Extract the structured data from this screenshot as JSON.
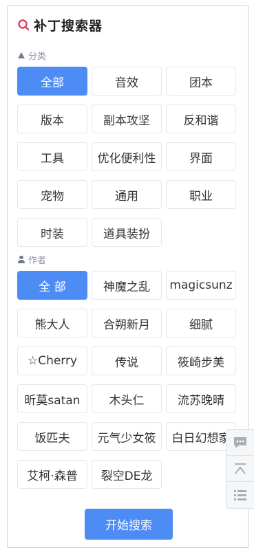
{
  "header": {
    "title": "补丁搜索器",
    "icon": "magnifier-icon"
  },
  "category": {
    "label": "分类",
    "items": [
      {
        "label": "全部",
        "active": true
      },
      {
        "label": "音效"
      },
      {
        "label": "团本"
      },
      {
        "label": "版本"
      },
      {
        "label": "副本攻坚"
      },
      {
        "label": "反和谐"
      },
      {
        "label": "工具"
      },
      {
        "label": "优化便利性"
      },
      {
        "label": "界面"
      },
      {
        "label": "宠物"
      },
      {
        "label": "通用"
      },
      {
        "label": "职业"
      },
      {
        "label": "时装"
      },
      {
        "label": "道具装扮"
      }
    ]
  },
  "author": {
    "label": "作者",
    "items": [
      {
        "label": "全 部",
        "active": true
      },
      {
        "label": "神魔之乱"
      },
      {
        "label": "magicsunz"
      },
      {
        "label": "熊大人"
      },
      {
        "label": "合朔新月"
      },
      {
        "label": "细腻"
      },
      {
        "label": "☆Cherry"
      },
      {
        "label": "传说"
      },
      {
        "label": "筱崎步美"
      },
      {
        "label": "昕莫satan"
      },
      {
        "label": "木头仁"
      },
      {
        "label": "流苏晚晴"
      },
      {
        "label": "饭匹夫"
      },
      {
        "label": "元气少女筱"
      },
      {
        "label": "白日幻想家"
      },
      {
        "label": "艾柯·森普"
      },
      {
        "label": "裂空DE龙"
      }
    ]
  },
  "actions": {
    "search_label": "开始搜索"
  },
  "side_toolbar": [
    "comment-icon",
    "back-to-top-icon",
    "list-icon"
  ],
  "colors": {
    "accent": "#4d8cf5",
    "logo_red": "#e0415a"
  }
}
